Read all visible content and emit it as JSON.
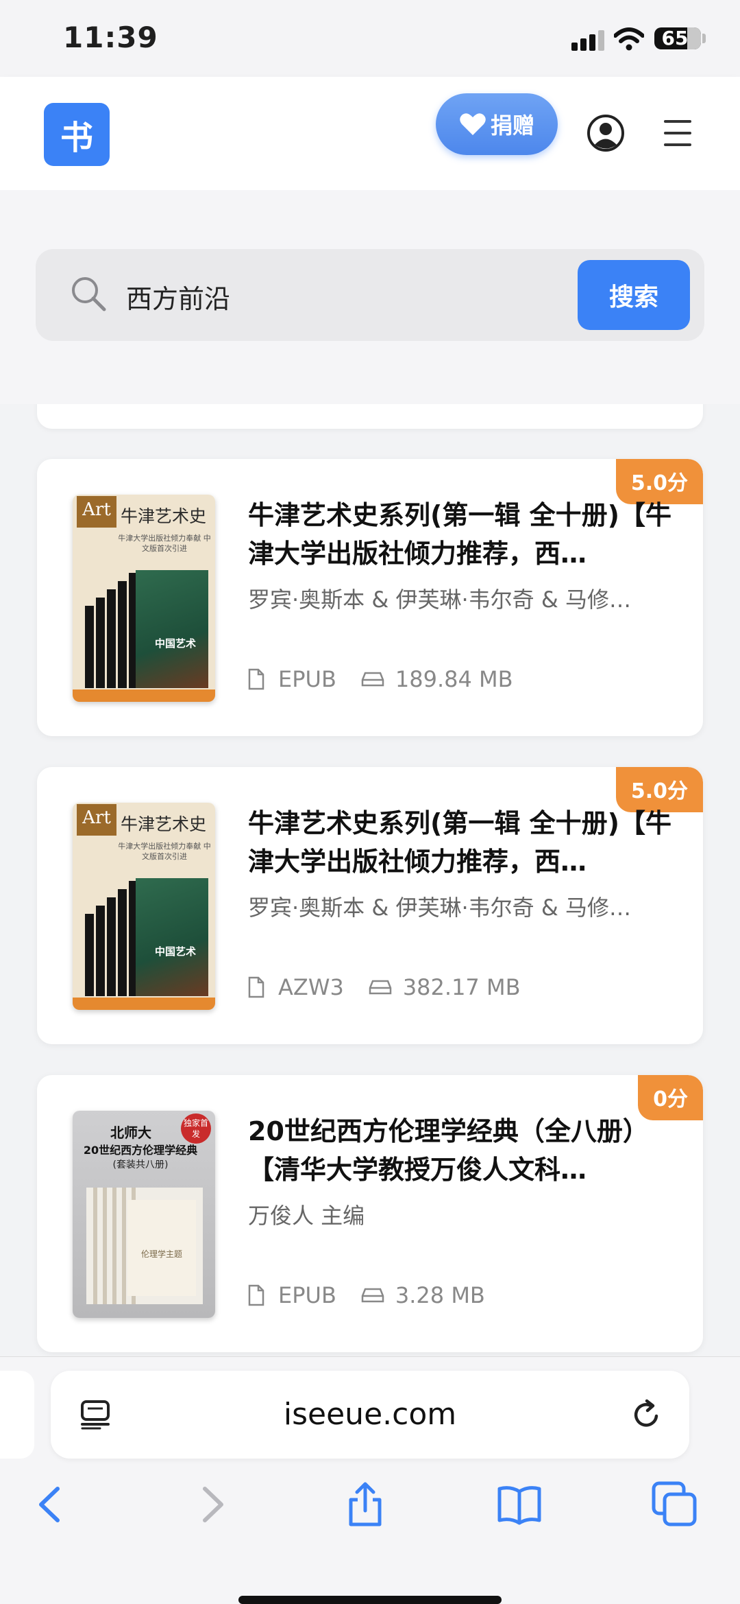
{
  "status_bar": {
    "time": "11:39",
    "battery": "65"
  },
  "header": {
    "logo": "书",
    "donate_label": "捐赠"
  },
  "search": {
    "value": "西方前沿",
    "button_label": "搜索"
  },
  "books": [
    {
      "rating": "5.0分",
      "title": "牛津艺术史系列(第一辑 全十册)【牛津大学出版社倾力推荐，西…",
      "author": "罗宾·奥斯本 & 伊芙琳·韦尔奇 & 马修…",
      "format": "EPUB",
      "size": "189.84 MB",
      "cover": {
        "art": "Art",
        "title": "牛津艺术史",
        "subtitle": "牛津大学出版社倾力奉献 中文版首次引进",
        "inner": "中国艺术"
      }
    },
    {
      "rating": "5.0分",
      "title": "牛津艺术史系列(第一辑 全十册)【牛津大学出版社倾力推荐，西…",
      "author": "罗宾·奥斯本 & 伊芙琳·韦尔奇 & 马修…",
      "format": "AZW3",
      "size": "382.17 MB",
      "cover": {
        "art": "Art",
        "title": "牛津艺术史",
        "subtitle": "牛津大学出版社倾力奉献 中文版首次引进",
        "inner": "中国艺术"
      }
    },
    {
      "rating": "0分",
      "title": "20世纪西方伦理学经典（全八册）【清华大学教授万俊人文科…",
      "author": "万俊人 主编",
      "format": "EPUB",
      "size": "3.28 MB",
      "cover": {
        "line1": "北师大",
        "line2": "20世纪西方伦理学经典",
        "line3": "(套装共八册)",
        "stamp": "独家首发",
        "inner": "伦理学主题"
      }
    }
  ],
  "browser": {
    "url": "iseeue.com"
  },
  "colors": {
    "accent": "#3b82f6",
    "badge": "#f0913a",
    "ios_blue": "#3b82f6"
  }
}
